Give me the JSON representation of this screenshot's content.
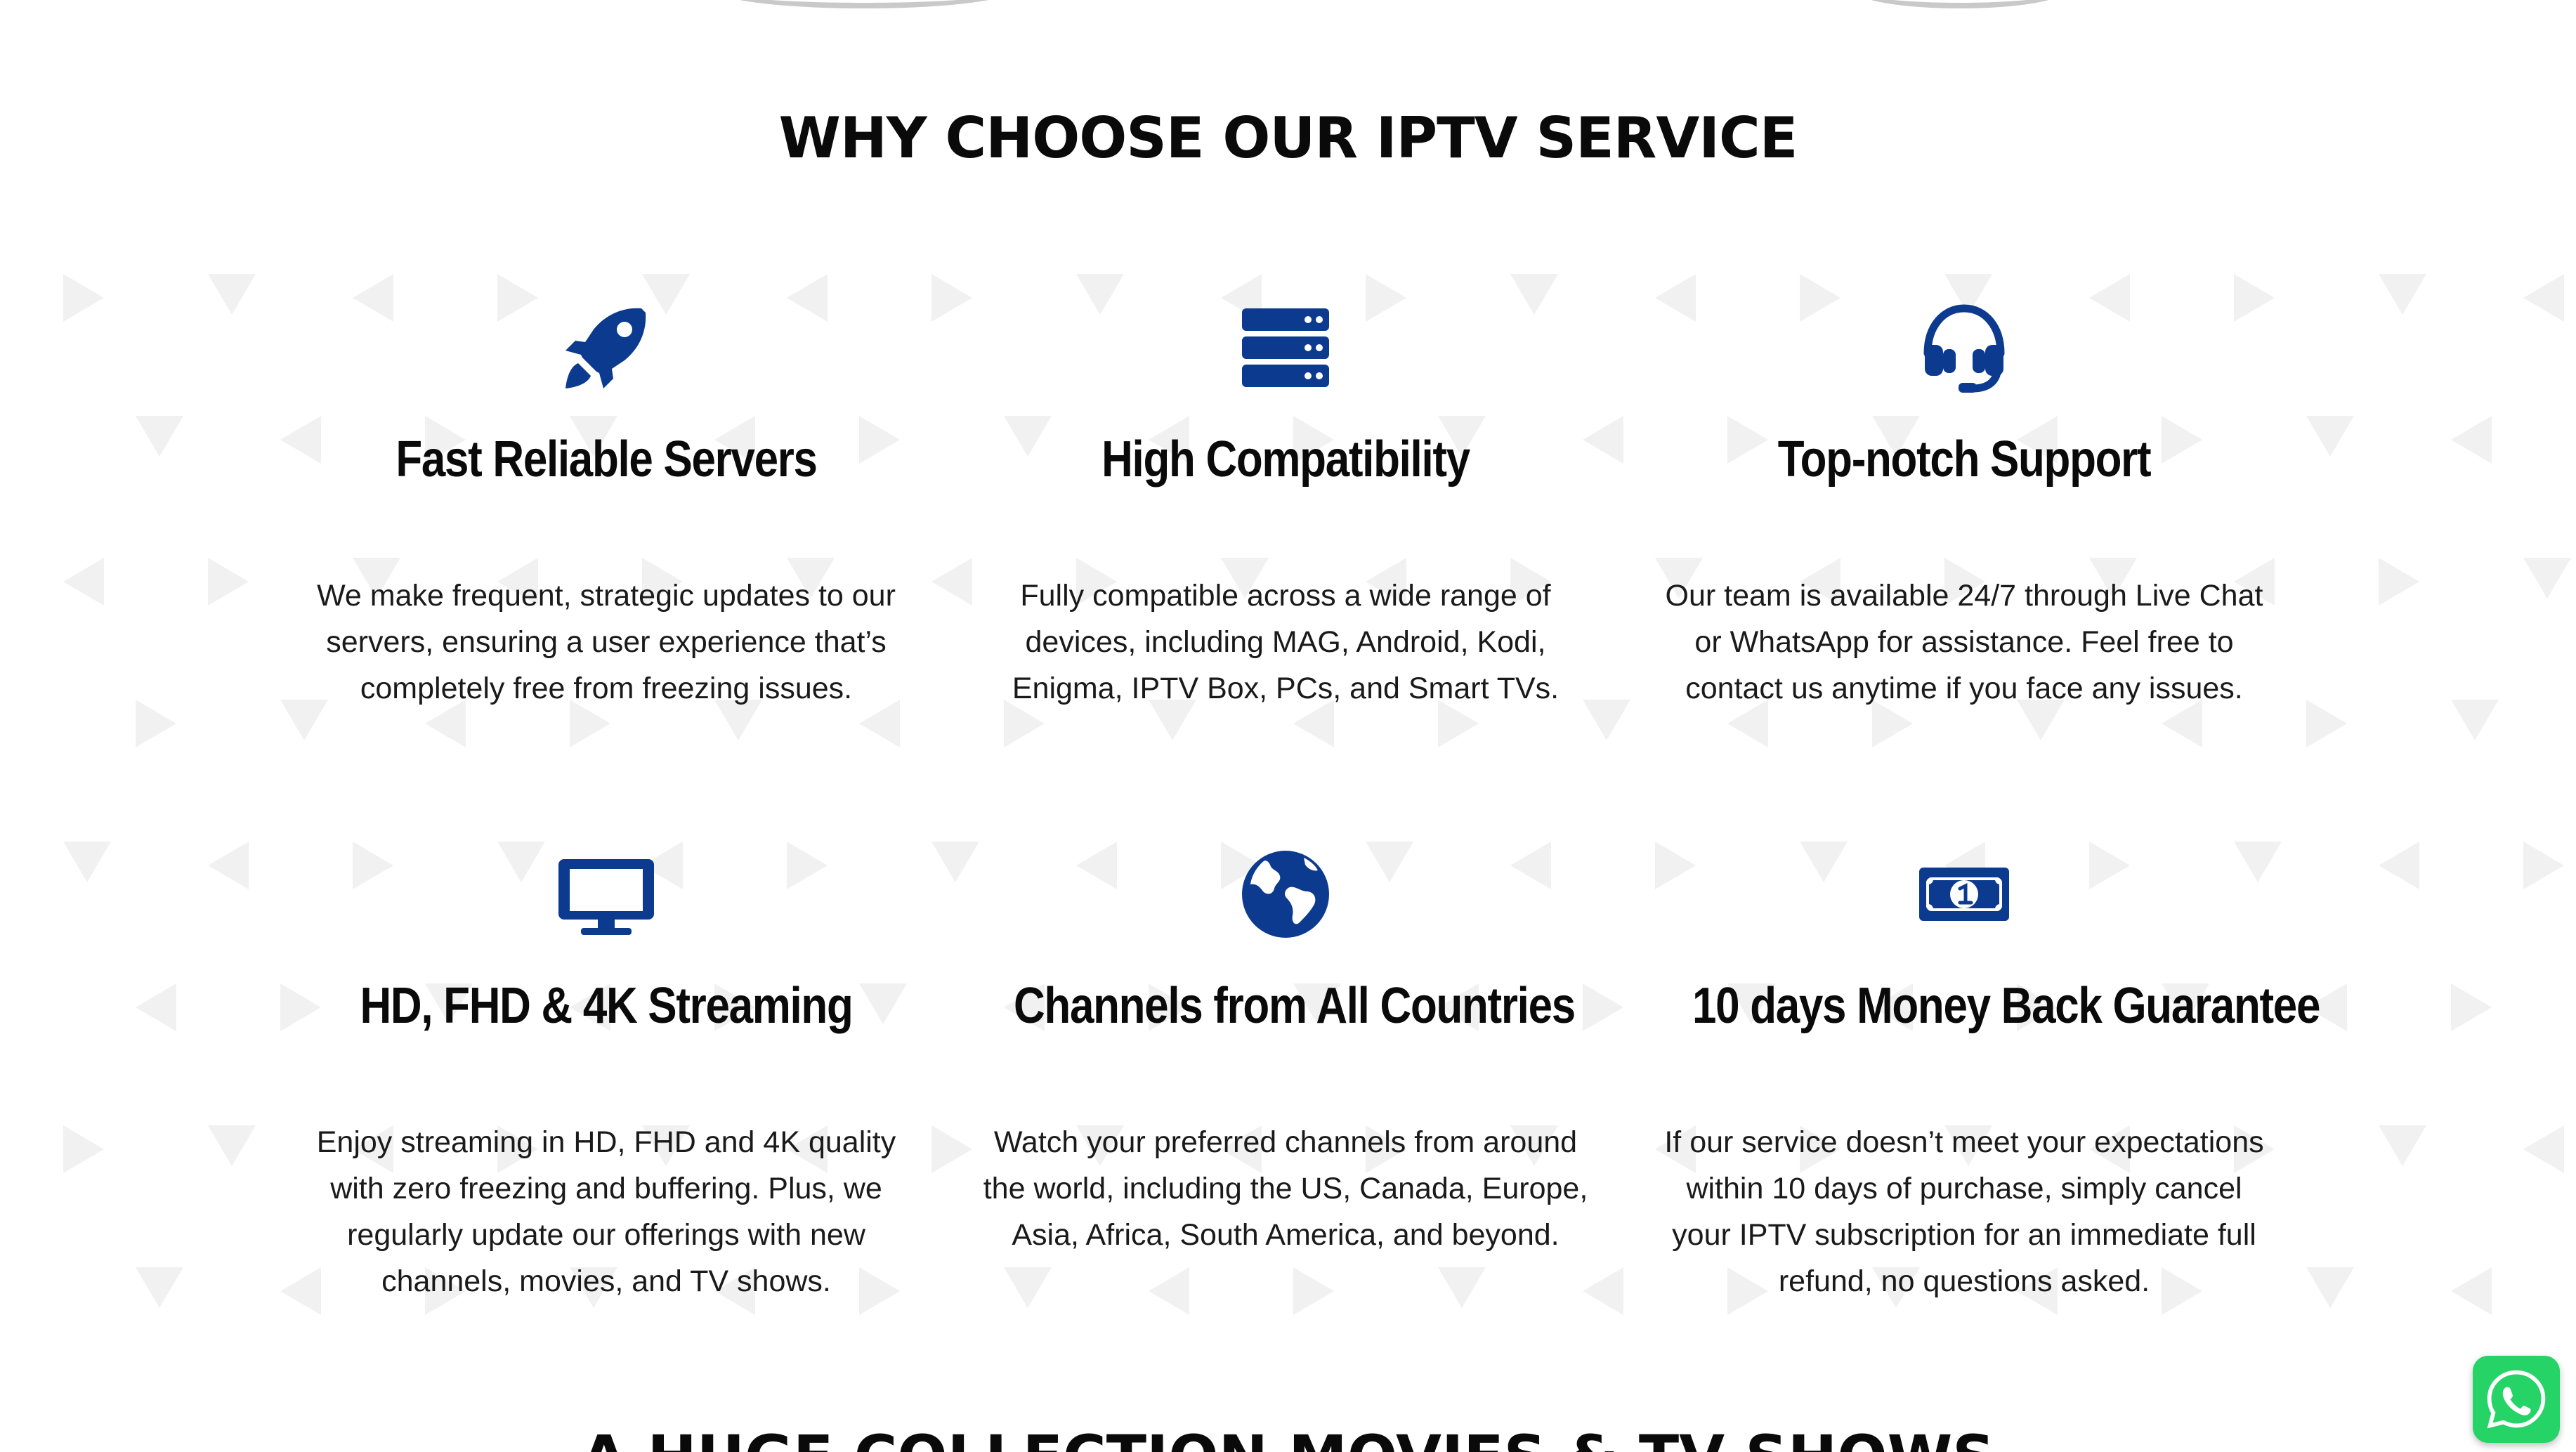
{
  "section": {
    "title": "WHY CHOOSE OUR IPTV SERVICE"
  },
  "colors": {
    "icon_blue": "#0b3a8f",
    "whatsapp_green": "#25d366",
    "pattern_gray": "#f1f1f1"
  },
  "features": [
    {
      "icon": "rocket-icon",
      "title": "Fast Reliable Servers",
      "description": "We make frequent, strategic updates to our servers, ensuring a user experience that’s completely free from freezing issues."
    },
    {
      "icon": "server-icon",
      "title": "High Compatibility",
      "description": "Fully compatible across a wide range of devices, including MAG, Android, Kodi, Enigma, IPTV Box, PCs, and Smart TVs."
    },
    {
      "icon": "headset-icon",
      "title": "Top-notch Support",
      "description": "Our team is available 24/7 through Live Chat or WhatsApp for assistance. Feel free to contact us anytime if you face any issues."
    },
    {
      "icon": "monitor-icon",
      "title": "HD, FHD & 4K Streaming",
      "description": "Enjoy streaming in HD, FHD and 4K quality with zero freezing and buffering. Plus, we regularly update our offerings with new channels, movies, and TV shows."
    },
    {
      "icon": "globe-icon",
      "title": "Channels from All Countries",
      "description": "Watch your preferred channels from around the world, including the US, Canada, Europe, Asia, Africa, South America, and beyond."
    },
    {
      "icon": "money-bill-icon",
      "title": "10 days Money Back Guarantee",
      "description": "If our service doesn’t meet your expectations within 10 days of purchase, simply cancel your IPTV subscription for an immediate full refund, no questions asked."
    }
  ],
  "next_section": {
    "title": "A HUGE COLLECTION MOVIES & TV SHOWS"
  },
  "whatsapp": {
    "icon": "whatsapp-icon"
  }
}
